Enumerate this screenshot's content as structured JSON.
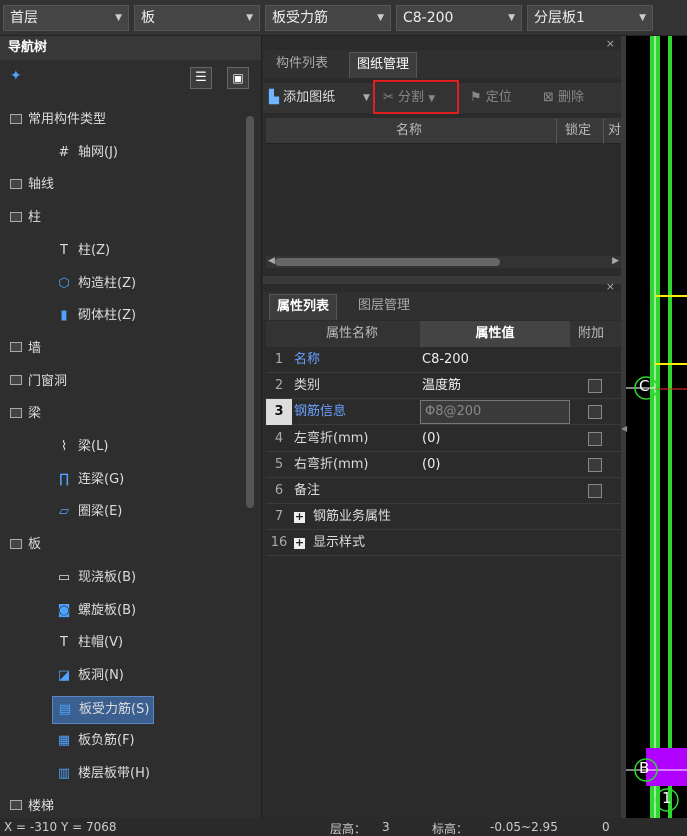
{
  "toolbar": {
    "floor": "首层",
    "component_type": "板",
    "component": "板受力筋",
    "spec": "C8-200",
    "layer": "分层板1"
  },
  "nav": {
    "title": "导航树",
    "items": [
      {
        "label": "常用构件类型",
        "kind": "category"
      },
      {
        "label": "轴网(J)",
        "kind": "item",
        "icon": "grid-icon"
      },
      {
        "label": "轴线",
        "kind": "category-collapsed"
      },
      {
        "label": "柱",
        "kind": "category"
      },
      {
        "label": "柱(Z)",
        "kind": "item",
        "icon": "column-icon"
      },
      {
        "label": "构造柱(Z)",
        "kind": "item",
        "icon": "construct-column-icon"
      },
      {
        "label": "砌体柱(Z)",
        "kind": "item",
        "icon": "masonry-column-icon"
      },
      {
        "label": "墙",
        "kind": "category-collapsed"
      },
      {
        "label": "门窗洞",
        "kind": "category-collapsed"
      },
      {
        "label": "梁",
        "kind": "category"
      },
      {
        "label": "梁(L)",
        "kind": "item",
        "icon": "beam-icon"
      },
      {
        "label": "连梁(G)",
        "kind": "item",
        "icon": "link-beam-icon"
      },
      {
        "label": "圈梁(E)",
        "kind": "item",
        "icon": "ring-beam-icon"
      },
      {
        "label": "板",
        "kind": "category"
      },
      {
        "label": "现浇板(B)",
        "kind": "item",
        "icon": "cast-slab-icon"
      },
      {
        "label": "螺旋板(B)",
        "kind": "item",
        "icon": "spiral-slab-icon"
      },
      {
        "label": "柱帽(V)",
        "kind": "item",
        "icon": "column-cap-icon"
      },
      {
        "label": "板洞(N)",
        "kind": "item",
        "icon": "slab-hole-icon"
      },
      {
        "label": "板受力筋(S)",
        "kind": "item",
        "icon": "slab-rebar-icon",
        "selected": true
      },
      {
        "label": "板负筋(F)",
        "kind": "item",
        "icon": "neg-rebar-icon"
      },
      {
        "label": "楼层板带(H)",
        "kind": "item",
        "icon": "slab-band-icon"
      },
      {
        "label": "楼梯",
        "kind": "category-collapsed"
      }
    ]
  },
  "drawing_panel": {
    "tabs": [
      "构件列表",
      "图纸管理"
    ],
    "active_tab": 1,
    "close": "×",
    "buttons": {
      "add": "添加图纸",
      "split": "分割",
      "locate": "定位",
      "delete": "删除"
    },
    "columns": [
      "名称",
      "锁定",
      "对"
    ]
  },
  "property_panel": {
    "tabs": [
      "属性列表",
      "图层管理"
    ],
    "active_tab": 0,
    "close": "×",
    "columns": [
      "属性名称",
      "属性值",
      "附加"
    ],
    "rows": [
      {
        "num": "1",
        "name": "名称",
        "value": "C8-200",
        "blue": true,
        "check": false
      },
      {
        "num": "2",
        "name": "类别",
        "value": "温度筋",
        "blue": false,
        "check": true
      },
      {
        "num": "3",
        "name": "钢筋信息",
        "value": "Φ8@200",
        "blue": true,
        "check": true,
        "editing": true
      },
      {
        "num": "4",
        "name": "左弯折(mm)",
        "value": "(0)",
        "blue": false,
        "check": true
      },
      {
        "num": "5",
        "name": "右弯折(mm)",
        "value": "(0)",
        "blue": false,
        "check": true
      },
      {
        "num": "6",
        "name": "备注",
        "value": "",
        "blue": false,
        "check": true
      },
      {
        "num": "7",
        "name": "钢筋业务属性",
        "value": "",
        "blue": false,
        "check": false,
        "group": true
      },
      {
        "num": "16",
        "name": "显示样式",
        "value": "",
        "blue": false,
        "check": false,
        "group": true
      }
    ]
  },
  "canvas": {
    "axis_labels": [
      "C",
      "B",
      "1"
    ]
  },
  "status": {
    "coords": "X = -310 Y = 7068",
    "floor_height_label": "层高：",
    "floor_height": "3",
    "elevation_label": "标高：",
    "elevation": "-0.05~2.95",
    "extra": "0"
  },
  "colors": {
    "accent_blue": "#3b5f8f",
    "highlight_red": "#e02020",
    "green_line": "#2ed82e",
    "yellow_line": "#ffee00",
    "magenta": "#b000ff"
  }
}
